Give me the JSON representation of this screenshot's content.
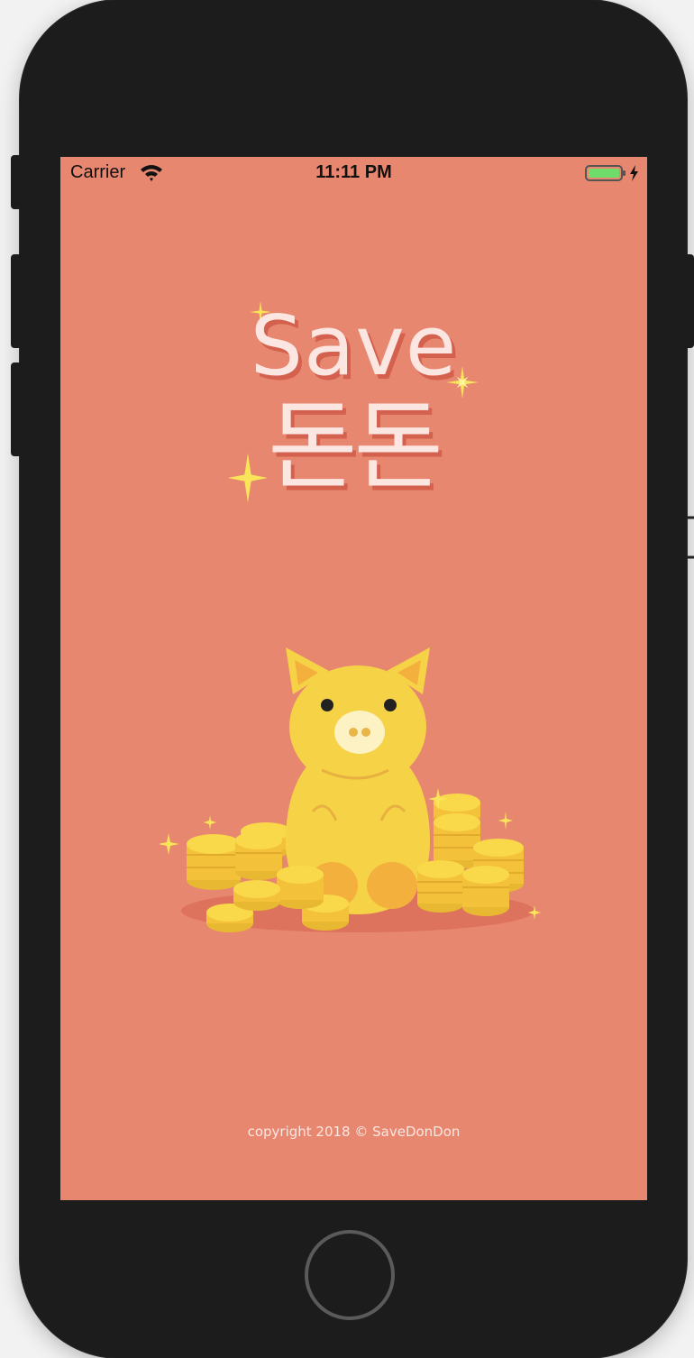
{
  "status_bar": {
    "carrier": "Carrier",
    "time": "11:11 PM",
    "wifi_icon": "wifi-icon",
    "battery_icon": "battery-charging-icon",
    "battery_color": "#6fdc6a"
  },
  "splash": {
    "title_line1": "Save",
    "title_line2": "돈돈",
    "illustration": "pig-with-coins",
    "copyright": "copyright 2018 © SaveDonDon"
  },
  "colors": {
    "background": "#e8876f",
    "title_text": "#fbe6e1",
    "title_shadow": "#d4604e",
    "pig": "#f6d346",
    "coin": "#f9d84a",
    "sparkle": "#f9e45a"
  },
  "device": {
    "home_button_icon": "home-button"
  }
}
